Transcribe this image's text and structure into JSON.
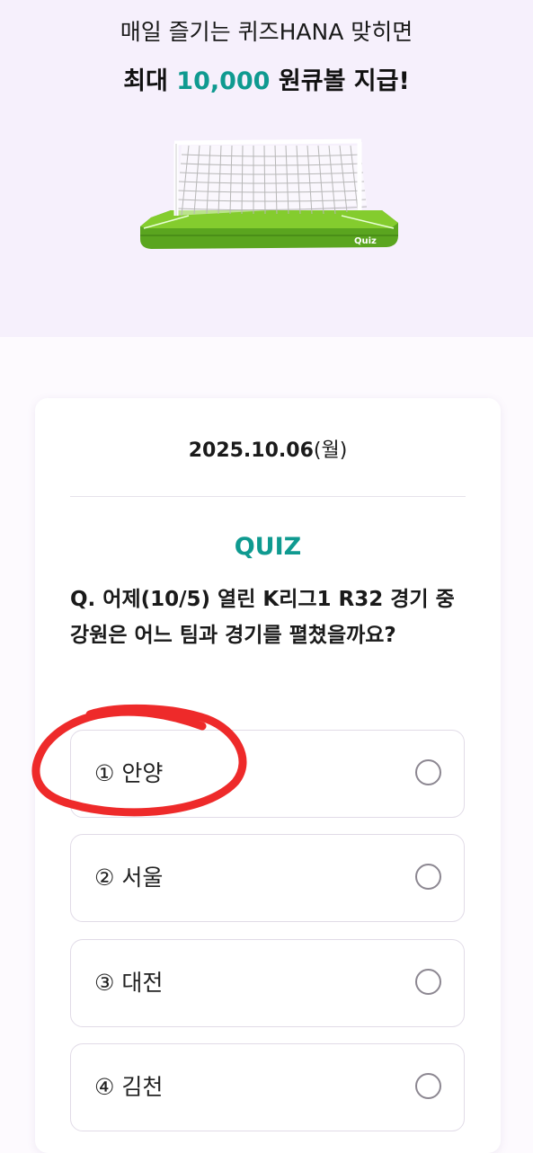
{
  "hero": {
    "line1": "매일 즐기는 퀴즈HANA 맞히면",
    "line2_prefix": "최대 ",
    "line2_amount": "10,000",
    "line2_suffix": " 원큐볼 지급!",
    "goal_badge": "Quiz",
    "accent_color": "#0f9a90"
  },
  "quiz": {
    "date": "2025.10.06",
    "weekday": "(월)",
    "label": "QUIZ",
    "question": "Q. 어제(10/5) 열린 K리그1 R32 경기 중 강원은 어느 팀과 경기를 펼쳤을까요?",
    "options": [
      {
        "label": "① 안양",
        "selected": false
      },
      {
        "label": "② 서울",
        "selected": false
      },
      {
        "label": "③ 대전",
        "selected": false
      },
      {
        "label": "④ 김천",
        "selected": false
      }
    ]
  },
  "annotation": {
    "circled_option": "① 안양",
    "stroke_color": "#ee2a2a"
  }
}
